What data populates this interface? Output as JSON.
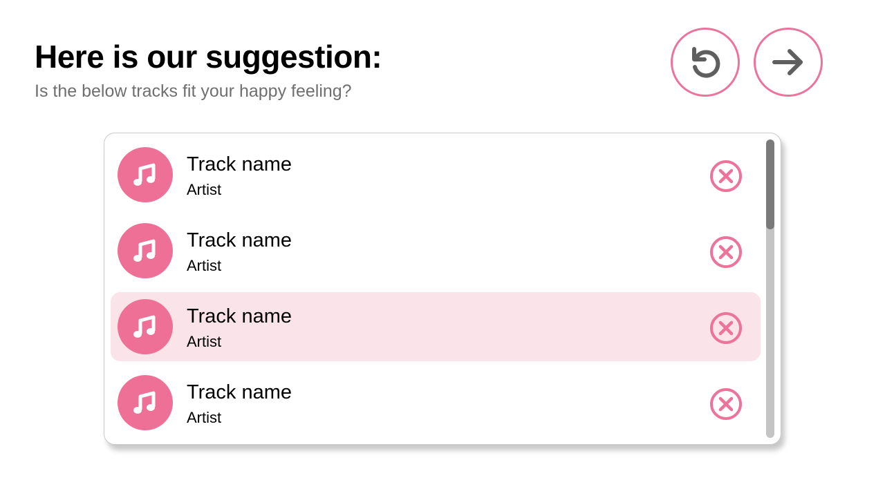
{
  "header": {
    "title": "Here is our suggestion:",
    "subtitle": "Is the below tracks fit your happy feeling?"
  },
  "actions": {
    "reload_icon": "reload-icon",
    "next_icon": "arrow-right-icon"
  },
  "colors": {
    "accent": "#ec7399",
    "selected_row": "#fae4ea",
    "icon_gray": "#5f5f5f"
  },
  "tracks": [
    {
      "name": "Track name",
      "artist": "Artist",
      "selected": false
    },
    {
      "name": "Track name",
      "artist": "Artist",
      "selected": false
    },
    {
      "name": "Track name",
      "artist": "Artist",
      "selected": true
    },
    {
      "name": "Track name",
      "artist": "Artist",
      "selected": false
    }
  ],
  "scroll": {
    "visible_fraction": 0.3,
    "position_fraction": 0.0
  }
}
